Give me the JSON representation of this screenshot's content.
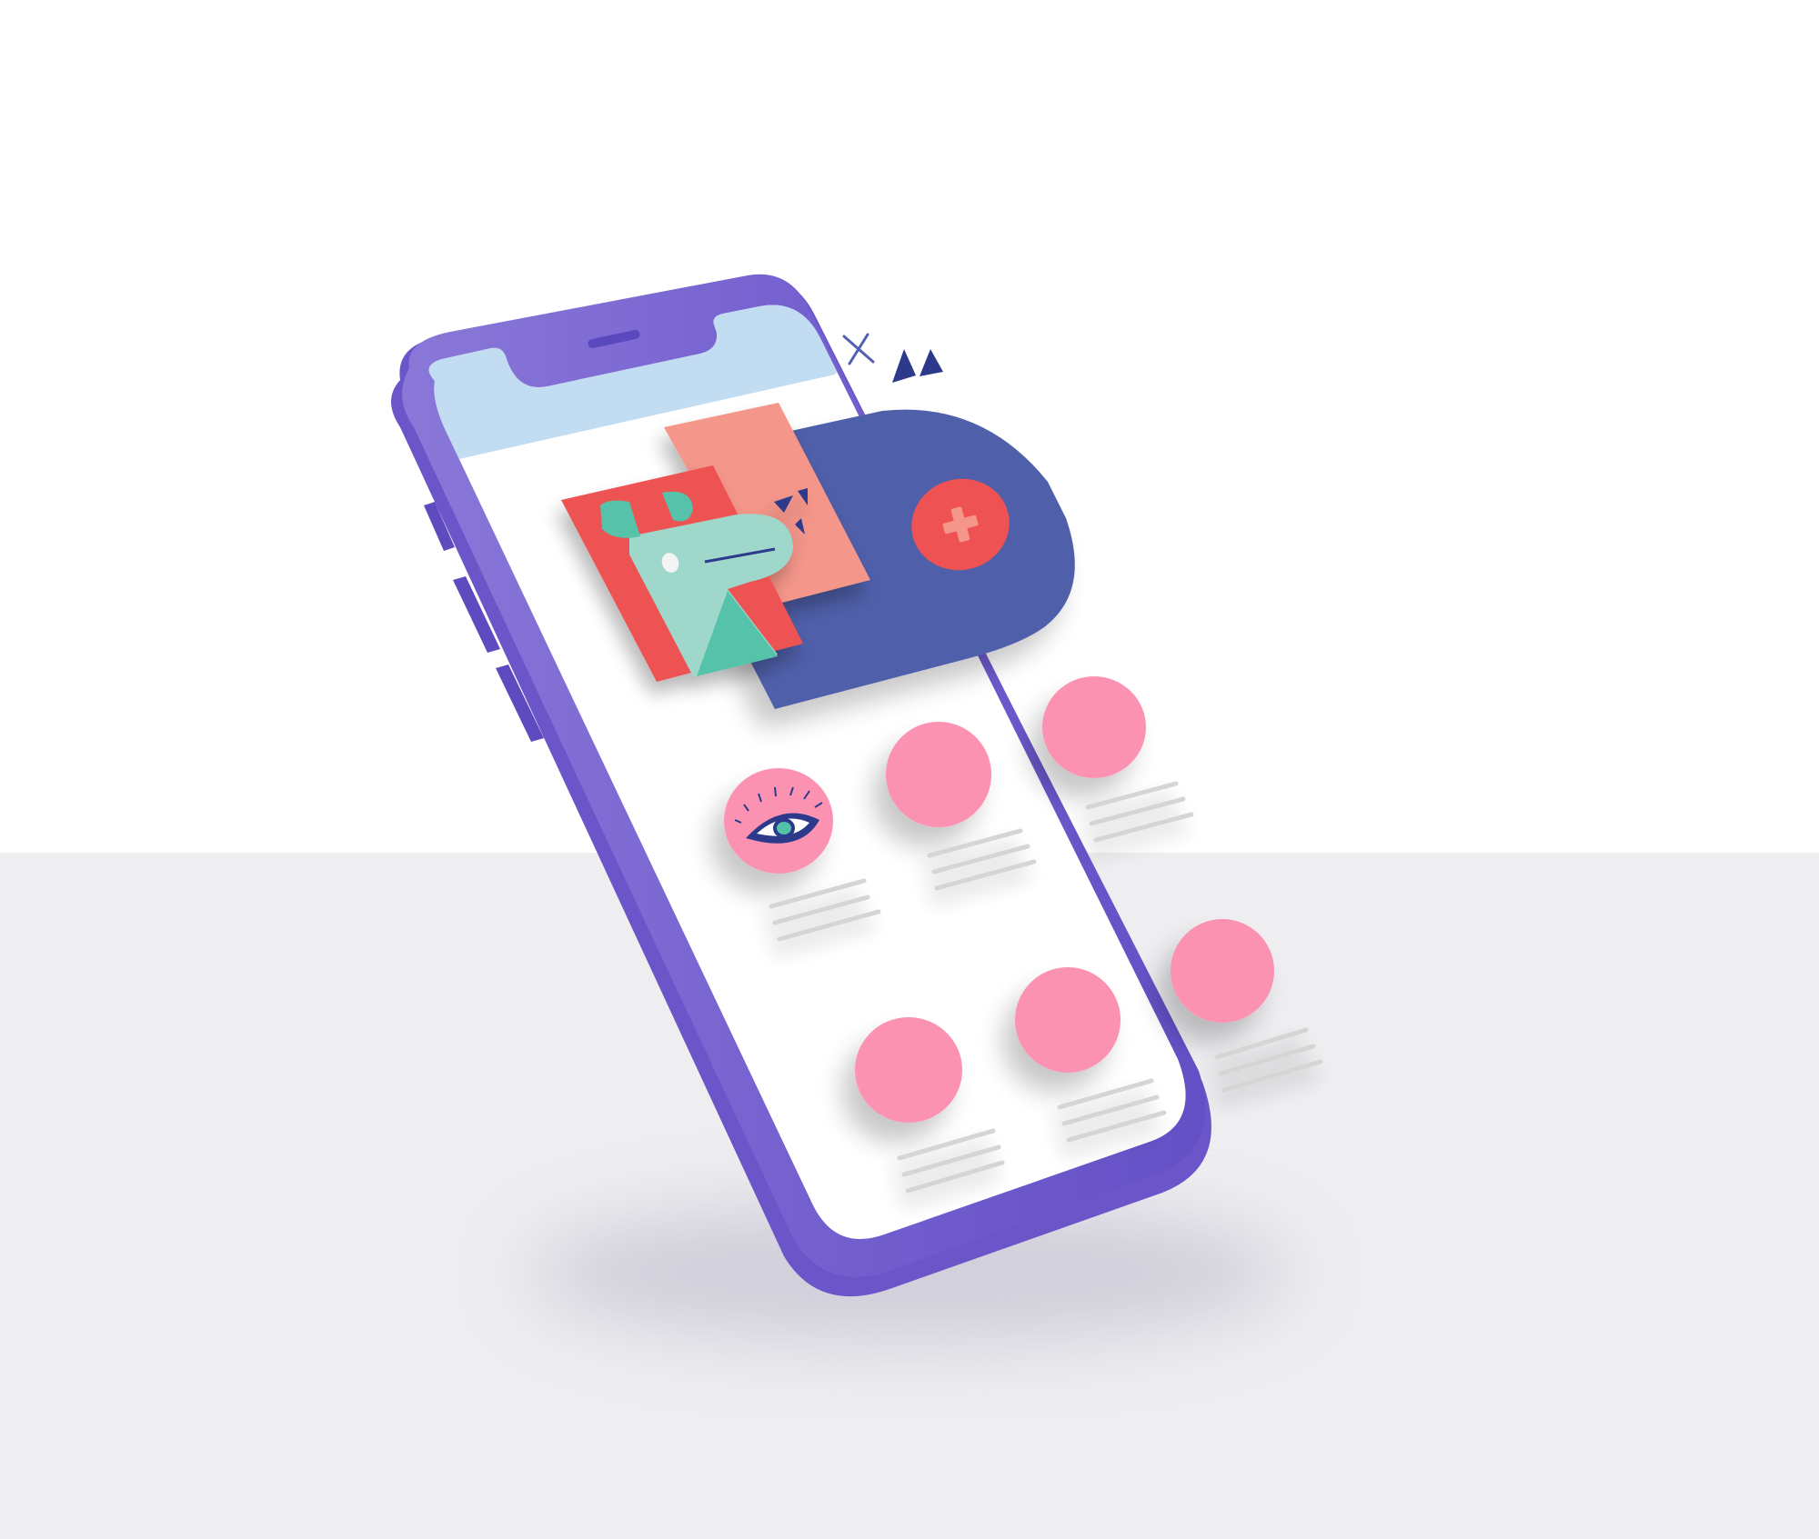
{
  "colors": {
    "background_top": "#FFFFFF",
    "background_floor": "#EEEEF1",
    "phone_frame": "#7560CF",
    "phone_frame_light": "#8A78D8",
    "phone_frame_dark": "#5E4BBF",
    "screen": "#FFFFFF",
    "header_bar": "#C2DCF2",
    "feature_card": "#505FA9",
    "accent_red": "#EE5253",
    "accent_salmon": "#F5968A",
    "accent_mint": "#9FD8CB",
    "accent_teal": "#54C2A9",
    "avatar_pink": "#FC92B2",
    "text_placeholder": "#D5D5D5",
    "navy": "#2D3A8C"
  },
  "icons": [
    "close-icon",
    "play-triangle-icon",
    "plus-icon",
    "eye-icon",
    "dog-illustration"
  ],
  "grid_items_count": 6
}
